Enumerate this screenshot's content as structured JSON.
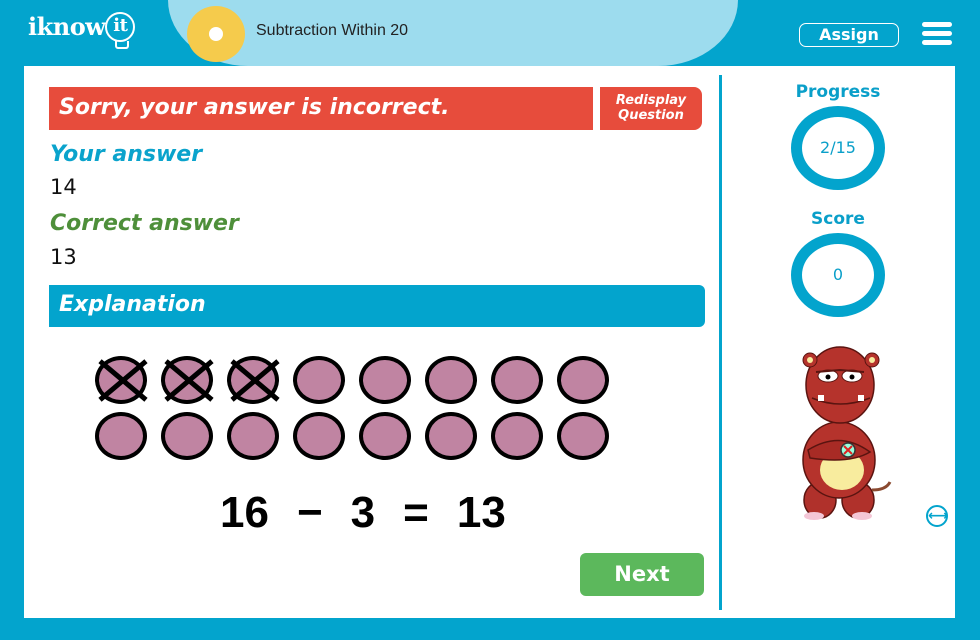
{
  "header": {
    "logo_text": "iknow",
    "logo_bulb_text": "it",
    "topic_title": "Subtraction Within 20",
    "assign_label": "Assign",
    "menu_icon": "hamburger-menu-icon"
  },
  "feedback": {
    "banner_text": "Sorry, your answer is incorrect.",
    "banner_color": "#e74c3c",
    "redisplay_line1": "Redisplay",
    "redisplay_line2": "Question",
    "your_answer_label": "Your answer",
    "your_answer_value": "14",
    "correct_answer_label": "Correct answer",
    "correct_answer_value": "13"
  },
  "explanation": {
    "title": "Explanation",
    "total_counters": 16,
    "crossed_out_counters": 3,
    "counter_color": "#c084a2",
    "equation": {
      "minuend": "16",
      "operator": "−",
      "subtrahend": "3",
      "equals": "=",
      "result": "13"
    }
  },
  "actions": {
    "next_label": "Next",
    "next_color": "#5cb85c"
  },
  "sidebar": {
    "progress_label": "Progress",
    "progress_value": "2/15",
    "score_label": "Score",
    "score_value": "0",
    "mascot": "grumpy-red-monster-mascot",
    "toggle_icon": "swap-arrows-icon"
  },
  "colors": {
    "frame": "#03a4cd",
    "header_band": "#9ddcee",
    "sun": "#f5cb4c",
    "correct_label": "#4e8f3a",
    "your_label": "#0aa3cc"
  }
}
